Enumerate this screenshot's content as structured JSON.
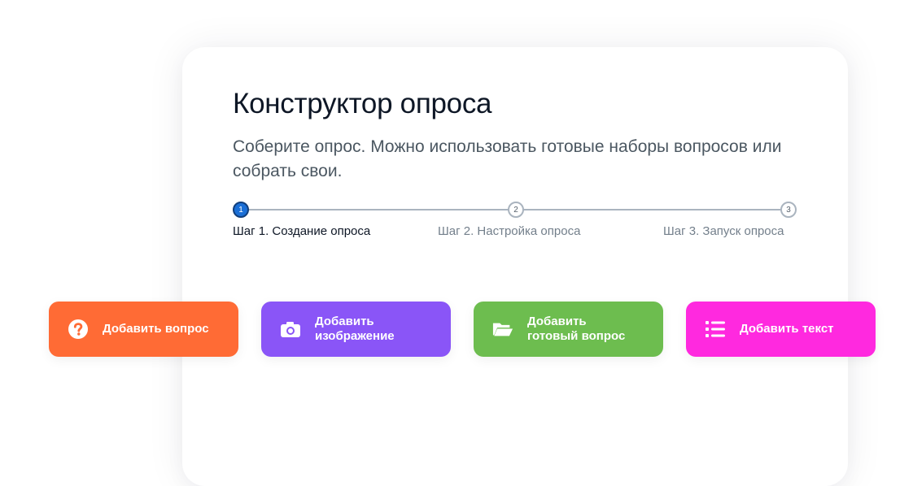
{
  "header": {
    "title": "Конструктор опроса",
    "subtitle": "Соберите опрос. Можно использовать готовые наборы вопросов или собрать свои."
  },
  "stepper": {
    "current_step": 1,
    "steps": [
      {
        "number": "1",
        "label": "Шаг 1. Создание опроса",
        "state": "active"
      },
      {
        "number": "2",
        "label": "Шаг 2. Настройка опроса",
        "state": "inactive"
      },
      {
        "number": "3",
        "label": "Шаг 3. Запуск опроса",
        "state": "inactive"
      }
    ]
  },
  "actions": [
    {
      "label": "Добавить вопрос",
      "icon": "question-circle-icon",
      "color": "#FF6B35"
    },
    {
      "label": "Добавить\nизображение",
      "icon": "camera-icon",
      "color": "#8A55F7"
    },
    {
      "label": "Добавить\nготовый вопрос",
      "icon": "folder-open-icon",
      "color": "#6DBD4F"
    },
    {
      "label": "Добавить текст",
      "icon": "list-icon",
      "color": "#FF29DF"
    }
  ],
  "colors": {
    "accent": "#1B6FD6",
    "title_text": "#0E1726",
    "muted_text": "#737F8B"
  }
}
